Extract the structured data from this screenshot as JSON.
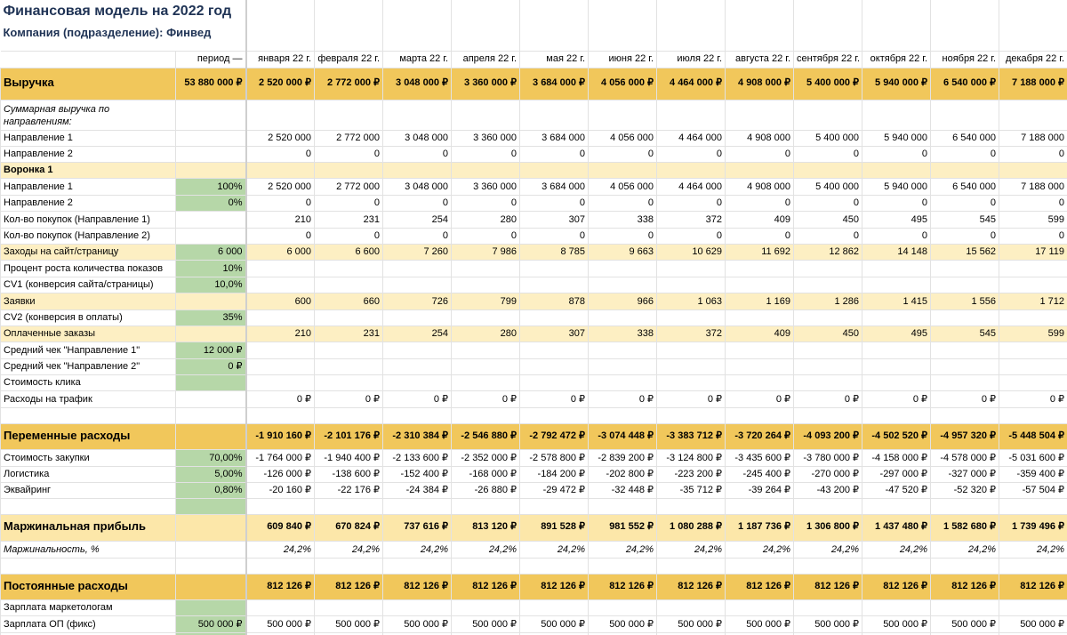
{
  "title": "Финансовая модель на 2022 год",
  "subtitle": "Компания (подразделение): Финвед",
  "period_header": "период —",
  "colors": {
    "header_gold": "#f1c75b",
    "light_yellow": "#fdefc3",
    "margin_yellow": "#fce7a9",
    "input_green": "#b6d7a8",
    "title_navy": "#1f3355"
  },
  "months": [
    "января 22 г.",
    "февраля 22 г.",
    "марта 22 г.",
    "апреля 22 г.",
    "мая 22 г.",
    "июня 22 г.",
    "июля 22 г.",
    "августа 22 г.",
    "сентября 22 г.",
    "октября 22 г.",
    "ноября 22 г.",
    "декабря 22 г."
  ],
  "rows": [
    {
      "id": "revenue",
      "style": "header",
      "label": "Выручка",
      "period": "53 880 000 ₽",
      "values": [
        "2 520 000 ₽",
        "2 772 000 ₽",
        "3 048 000 ₽",
        "3 360 000 ₽",
        "3 684 000 ₽",
        "4 056 000 ₽",
        "4 464 000 ₽",
        "4 908 000 ₽",
        "5 400 000 ₽",
        "5 940 000 ₽",
        "6 540 000 ₽",
        "7 188 000 ₽"
      ]
    },
    {
      "id": "revenue-by-direction",
      "style": "note",
      "label": "Суммарная выручка по направлениям:"
    },
    {
      "id": "direction-1-total",
      "style": "normal",
      "label": "Направление 1",
      "values": [
        "2 520 000",
        "2 772 000",
        "3 048 000",
        "3 360 000",
        "3 684 000",
        "4 056 000",
        "4 464 000",
        "4 908 000",
        "5 400 000",
        "5 940 000",
        "6 540 000",
        "7 188 000"
      ]
    },
    {
      "id": "direction-2-total",
      "style": "normal",
      "label": "Направление 2",
      "values": [
        "0",
        "0",
        "0",
        "0",
        "0",
        "0",
        "0",
        "0",
        "0",
        "0",
        "0",
        "0"
      ]
    },
    {
      "id": "funnel-1",
      "style": "sub",
      "label": "Воронка 1"
    },
    {
      "id": "funnel-direction-1",
      "style": "normal",
      "label": "Направление 1",
      "period": "100%",
      "period_input": true,
      "values": [
        "2 520 000",
        "2 772 000",
        "3 048 000",
        "3 360 000",
        "3 684 000",
        "4 056 000",
        "4 464 000",
        "4 908 000",
        "5 400 000",
        "5 940 000",
        "6 540 000",
        "7 188 000"
      ]
    },
    {
      "id": "funnel-direction-2",
      "style": "normal",
      "label": "Направление 2",
      "period": "0%",
      "period_input": true,
      "values": [
        "0",
        "0",
        "0",
        "0",
        "0",
        "0",
        "0",
        "0",
        "0",
        "0",
        "0",
        "0"
      ]
    },
    {
      "id": "purchases-direction-1",
      "style": "normal",
      "label": "Кол-во покупок (Направление 1)",
      "values": [
        "210",
        "231",
        "254",
        "280",
        "307",
        "338",
        "372",
        "409",
        "450",
        "495",
        "545",
        "599"
      ]
    },
    {
      "id": "purchases-direction-2",
      "style": "normal",
      "label": "Кол-во покупок (Направление 2)",
      "values": [
        "0",
        "0",
        "0",
        "0",
        "0",
        "0",
        "0",
        "0",
        "0",
        "0",
        "0",
        "0"
      ]
    },
    {
      "id": "site-visits",
      "style": "hl",
      "label": "Заходы на сайт/страницу",
      "period": "6 000",
      "period_input": true,
      "values": [
        "6 000",
        "6 600",
        "7 260",
        "7 986",
        "8 785",
        "9 663",
        "10 629",
        "11 692",
        "12 862",
        "14 148",
        "15 562",
        "17 119"
      ]
    },
    {
      "id": "impressions-growth",
      "style": "normal",
      "label": "Процент роста количества показов",
      "period": "10%",
      "period_input": true
    },
    {
      "id": "cv1",
      "style": "normal",
      "label": "CV1 (конверсия сайта/страницы)",
      "period": "10,0%",
      "period_input": true
    },
    {
      "id": "leads",
      "style": "hl",
      "label": "Заявки",
      "values": [
        "600",
        "660",
        "726",
        "799",
        "878",
        "966",
        "1 063",
        "1 169",
        "1 286",
        "1 415",
        "1 556",
        "1 712"
      ]
    },
    {
      "id": "cv2",
      "style": "normal",
      "label": "CV2 (конверсия в оплаты)",
      "period": "35%",
      "period_input": true
    },
    {
      "id": "paid-orders",
      "style": "hl",
      "label": "Оплаченные заказы",
      "values": [
        "210",
        "231",
        "254",
        "280",
        "307",
        "338",
        "372",
        "409",
        "450",
        "495",
        "545",
        "599"
      ]
    },
    {
      "id": "avg-check-1",
      "style": "normal",
      "label": "Средний чек \"Направление 1\"",
      "period": "12 000 ₽",
      "period_input": true
    },
    {
      "id": "avg-check-2",
      "style": "normal",
      "label": "Средний чек \"Направление 2\"",
      "period": "0 ₽",
      "period_input": true
    },
    {
      "id": "click-cost",
      "style": "normal",
      "label": "Стоимость клика",
      "period_input": true
    },
    {
      "id": "traffic-costs",
      "style": "normal",
      "label": "Расходы на трафик",
      "values": [
        "0 ₽",
        "0 ₽",
        "0 ₽",
        "0 ₽",
        "0 ₽",
        "0 ₽",
        "0 ₽",
        "0 ₽",
        "0 ₽",
        "0 ₽",
        "0 ₽",
        "0 ₽"
      ]
    },
    {
      "id": "spacer-1",
      "style": "normal"
    },
    {
      "id": "variable-costs",
      "style": "header",
      "label": "Переменные расходы",
      "values": [
        "-1 910 160 ₽",
        "-2 101 176 ₽",
        "-2 310 384 ₽",
        "-2 546 880 ₽",
        "-2 792 472 ₽",
        "-3 074 448 ₽",
        "-3 383 712 ₽",
        "-3 720 264 ₽",
        "-4 093 200 ₽",
        "-4 502 520 ₽",
        "-4 957 320 ₽",
        "-5 448 504 ₽"
      ]
    },
    {
      "id": "purchase-cost",
      "style": "normal",
      "label": "Стоимость закупки",
      "period": "70,00%",
      "period_input": true,
      "values": [
        "-1 764 000 ₽",
        "-1 940 400 ₽",
        "-2 133 600 ₽",
        "-2 352 000 ₽",
        "-2 578 800 ₽",
        "-2 839 200 ₽",
        "-3 124 800 ₽",
        "-3 435 600 ₽",
        "-3 780 000 ₽",
        "-4 158 000 ₽",
        "-4 578 000 ₽",
        "-5 031 600 ₽"
      ]
    },
    {
      "id": "logistics",
      "style": "normal",
      "label": "Логистика",
      "period": "5,00%",
      "period_input": true,
      "values": [
        "-126 000 ₽",
        "-138 600 ₽",
        "-152 400 ₽",
        "-168 000 ₽",
        "-184 200 ₽",
        "-202 800 ₽",
        "-223 200 ₽",
        "-245 400 ₽",
        "-270 000 ₽",
        "-297 000 ₽",
        "-327 000 ₽",
        "-359 400 ₽"
      ]
    },
    {
      "id": "acquiring",
      "style": "normal",
      "label": "Эквайринг",
      "period": "0,80%",
      "period_input": true,
      "values": [
        "-20 160 ₽",
        "-22 176 ₽",
        "-24 384 ₽",
        "-26 880 ₽",
        "-29 472 ₽",
        "-32 448 ₽",
        "-35 712 ₽",
        "-39 264 ₽",
        "-43 200 ₽",
        "-47 520 ₽",
        "-52 320 ₽",
        "-57 504 ₽"
      ]
    },
    {
      "id": "spacer-2",
      "style": "normal",
      "period_input": true
    },
    {
      "id": "margin-profit",
      "style": "margin",
      "label": "Маржинальная прибыль",
      "values": [
        "609 840 ₽",
        "670 824 ₽",
        "737 616 ₽",
        "813 120 ₽",
        "891 528 ₽",
        "981 552 ₽",
        "1 080 288 ₽",
        "1 187 736 ₽",
        "1 306 800 ₽",
        "1 437 480 ₽",
        "1 582 680 ₽",
        "1 739 496 ₽"
      ]
    },
    {
      "id": "margin-percent",
      "style": "italic",
      "label": "Маржинальность, %",
      "values": [
        "24,2%",
        "24,2%",
        "24,2%",
        "24,2%",
        "24,2%",
        "24,2%",
        "24,2%",
        "24,2%",
        "24,2%",
        "24,2%",
        "24,2%",
        "24,2%"
      ]
    },
    {
      "id": "spacer-3",
      "style": "normal"
    },
    {
      "id": "fixed-costs",
      "style": "header",
      "label": "Постоянные расходы",
      "values": [
        "812 126 ₽",
        "812 126 ₽",
        "812 126 ₽",
        "812 126 ₽",
        "812 126 ₽",
        "812 126 ₽",
        "812 126 ₽",
        "812 126 ₽",
        "812 126 ₽",
        "812 126 ₽",
        "812 126 ₽",
        "812 126 ₽"
      ]
    },
    {
      "id": "marketers-salary",
      "style": "normal",
      "label": "Зарплата маркетологам",
      "period_input": true
    },
    {
      "id": "sales-salary",
      "style": "normal",
      "label": "Зарплата ОП (фикс)",
      "period": "500 000 ₽",
      "period_input": true,
      "values": [
        "500 000 ₽",
        "500 000 ₽",
        "500 000 ₽",
        "500 000 ₽",
        "500 000 ₽",
        "500 000 ₽",
        "500 000 ₽",
        "500 000 ₽",
        "500 000 ₽",
        "500 000 ₽",
        "500 000 ₽",
        "500 000 ₽"
      ]
    },
    {
      "id": "next-row",
      "style": "sliver",
      "period_input": true
    }
  ]
}
